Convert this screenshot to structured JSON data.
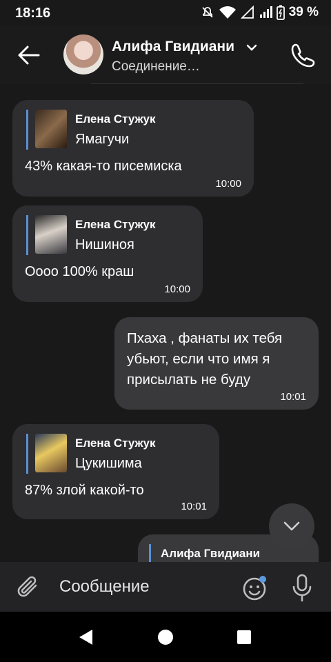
{
  "status_bar": {
    "time": "18:16",
    "battery": "39 %"
  },
  "header": {
    "contact_name": "Алифа Гвидиани",
    "connection_status": "Соединение…"
  },
  "messages": [
    {
      "direction": "in",
      "reply_author": "Елена Стужук",
      "reply_text": "Ямагучи",
      "text": "43% какая-то писемиска",
      "time": "10:00"
    },
    {
      "direction": "in",
      "reply_author": "Елена Стужук",
      "reply_text": "Нишиноя",
      "text": "Оооо 100% краш",
      "time": "10:00"
    },
    {
      "direction": "out",
      "text": "Пхаха , фанаты их тебя убьют, если что имя я присылать не буду",
      "time": "10:01"
    },
    {
      "direction": "in",
      "reply_author": "Елена Стужук",
      "reply_text": "Цукишима",
      "text": "87% злой какой-то",
      "time": "10:01"
    },
    {
      "direction": "out",
      "reply_author": "Алифа Гвидиани"
    }
  ],
  "composer": {
    "placeholder": "Сообщение"
  },
  "icons": {
    "back": "arrow-left-icon",
    "call": "phone-icon",
    "attach": "paperclip-icon",
    "emoji": "emoji-icon",
    "mic": "microphone-icon",
    "scroll": "chevron-down-icon"
  },
  "colors": {
    "background": "#19191a",
    "incoming_bubble": "#2e2e31",
    "outgoing_bubble": "#39393c",
    "reply_accent": "#5b8fd6"
  }
}
